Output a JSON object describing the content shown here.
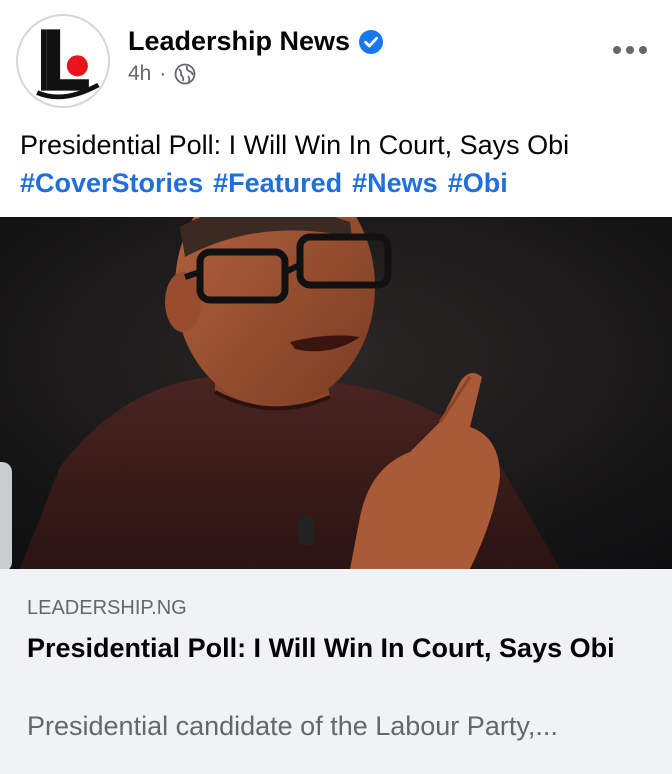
{
  "post": {
    "page_name": "Leadership News",
    "time": "4h",
    "separator": "·",
    "text": "Presidential Poll: I Will Win In Court, Says Obi",
    "hashtags": [
      "#CoverStories",
      "#Featured",
      "#News",
      "#Obi"
    ]
  },
  "link_preview": {
    "domain": "LEADERSHIP.NG",
    "title": "Presidential Poll: I Will Win In Court, Says Obi",
    "description": "Presidential candidate of the Labour Party,..."
  },
  "icons": {
    "avatar": "leadership-logo-icon",
    "verified": "verified-badge-icon",
    "audience": "globe-icon",
    "more": "more-options-icon"
  },
  "colors": {
    "accent": "#216fdb",
    "verified": "#1877f2",
    "logo_red": "#e8141c",
    "secondary_text": "#65676b",
    "card_bg": "#f0f2f5"
  }
}
